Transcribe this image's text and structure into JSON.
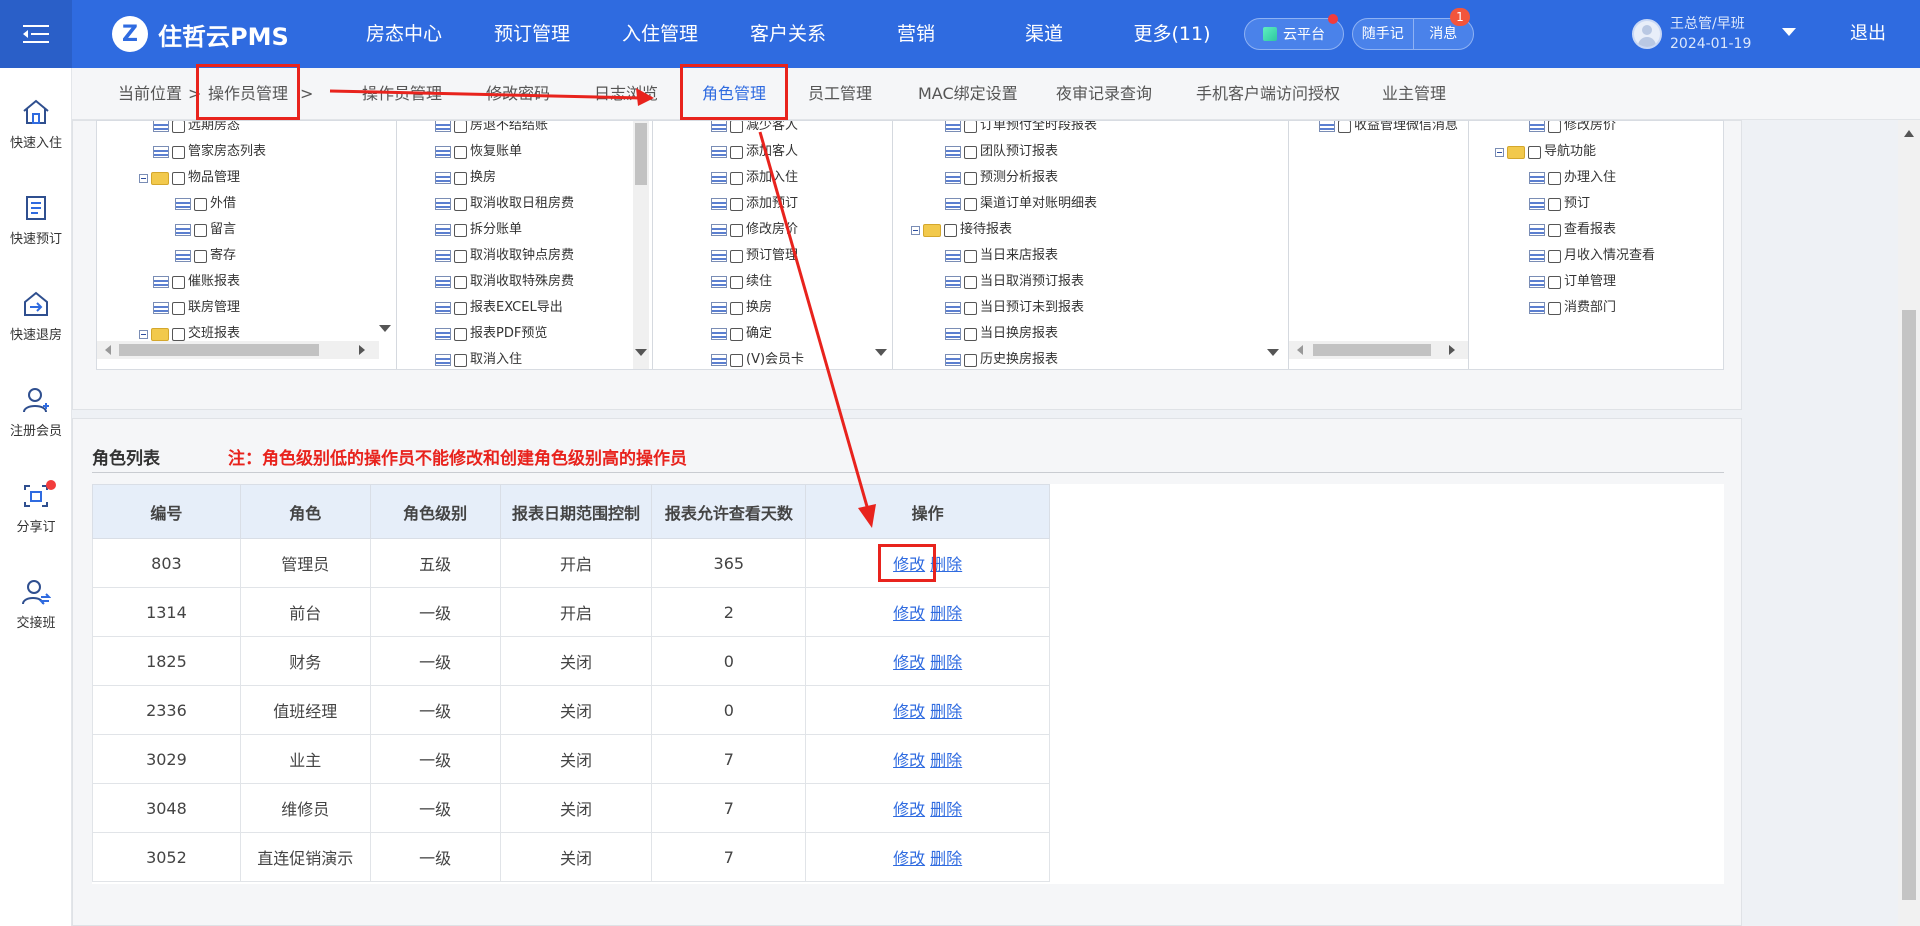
{
  "app": {
    "logo_text": "住哲云PMS",
    "logo_glyph": "Z"
  },
  "nav": [
    {
      "label": "房态中心"
    },
    {
      "label": "预订管理"
    },
    {
      "label": "入住管理"
    },
    {
      "label": "客户关系"
    },
    {
      "label": "营销"
    },
    {
      "label": "渠道"
    },
    {
      "label": "更多(11)"
    }
  ],
  "header": {
    "cloud_label": "云平台",
    "notes_label": "随手记",
    "messages_label": "消息",
    "messages_badge": "1",
    "user_name": "王总管/早班",
    "user_date": "2024-01-19",
    "logout": "退出"
  },
  "sidebar": [
    {
      "label": "快速入住",
      "icon": "home-icon"
    },
    {
      "label": "快速预订",
      "icon": "notebook-icon"
    },
    {
      "label": "快速退房",
      "icon": "checkout-icon"
    },
    {
      "label": "注册会员",
      "icon": "user-add-icon"
    },
    {
      "label": "分享订",
      "icon": "share-order-icon"
    },
    {
      "label": "交接班",
      "icon": "handover-icon"
    }
  ],
  "breadcrumb": {
    "label": "当前位置",
    "sep": ">",
    "current": "操作员管理",
    "sep2": ">"
  },
  "tabs": [
    {
      "label": "操作员管理"
    },
    {
      "label": "修改密码"
    },
    {
      "label": "日志浏览"
    },
    {
      "label": "角色管理"
    },
    {
      "label": "员工管理"
    },
    {
      "label": "MAC绑定设置"
    },
    {
      "label": "夜审记录查询"
    },
    {
      "label": "手机客户端访问授权"
    },
    {
      "label": "业主管理"
    }
  ],
  "tree": {
    "col1": [
      "远期房态",
      "管家房态列表",
      "物品管理",
      "外借",
      "留言",
      "寄存",
      "催账报表",
      "联房管理",
      "交班报表"
    ],
    "col2": [
      "房退不结结账",
      "恢复账单",
      "换房",
      "取消收取日租房费",
      "拆分账单",
      "取消收取钟点房费",
      "取消收取特殊房费",
      "报表EXCEL导出",
      "报表PDF预览",
      "取消入住"
    ],
    "col3": [
      "减少客人",
      "添加客人",
      "添加入住",
      "添加预订",
      "修改房价",
      "预订管理",
      "续住",
      "换房",
      "确定",
      "(V)会员卡"
    ],
    "col4": [
      "订单预付全时段报表",
      "团队预订报表",
      "预测分析报表",
      "渠道订单对账明细表",
      "接待报表",
      "当日来店报表",
      "当日取消预订报表",
      "当日预订未到报表",
      "当日换房报表",
      "历史换房报表"
    ],
    "col5": [
      "收益管理微信消息"
    ],
    "col6": [
      "修改房价",
      "导航功能",
      "办理入住",
      "预订",
      "查看报表",
      "月收入情况查看",
      "订单管理",
      "消费部门"
    ]
  },
  "role_list": {
    "title": "角色列表",
    "note": "注：角色级别低的操作员不能修改和创建角色级别高的操作员",
    "headers": [
      "编号",
      "角色",
      "角色级别",
      "报表日期范围控制",
      "报表允许查看天数",
      "操作"
    ],
    "rows": [
      {
        "id": "803",
        "role": "管理员",
        "level": "五级",
        "date_ctrl": "开启",
        "days": "365"
      },
      {
        "id": "1314",
        "role": "前台",
        "level": "一级",
        "date_ctrl": "开启",
        "days": "2"
      },
      {
        "id": "1825",
        "role": "财务",
        "level": "一级",
        "date_ctrl": "关闭",
        "days": "0"
      },
      {
        "id": "2336",
        "role": "值班经理",
        "level": "一级",
        "date_ctrl": "关闭",
        "days": "0"
      },
      {
        "id": "3029",
        "role": "业主",
        "level": "一级",
        "date_ctrl": "关闭",
        "days": "7"
      },
      {
        "id": "3048",
        "role": "维修员",
        "level": "一级",
        "date_ctrl": "关闭",
        "days": "7"
      },
      {
        "id": "3052",
        "role": "直连促销演示",
        "level": "一级",
        "date_ctrl": "关闭",
        "days": "7"
      }
    ],
    "edit_label": "修改",
    "delete_label": "删除"
  },
  "colors": {
    "brand": "#2f6be0",
    "annotation": "#e8231d"
  }
}
